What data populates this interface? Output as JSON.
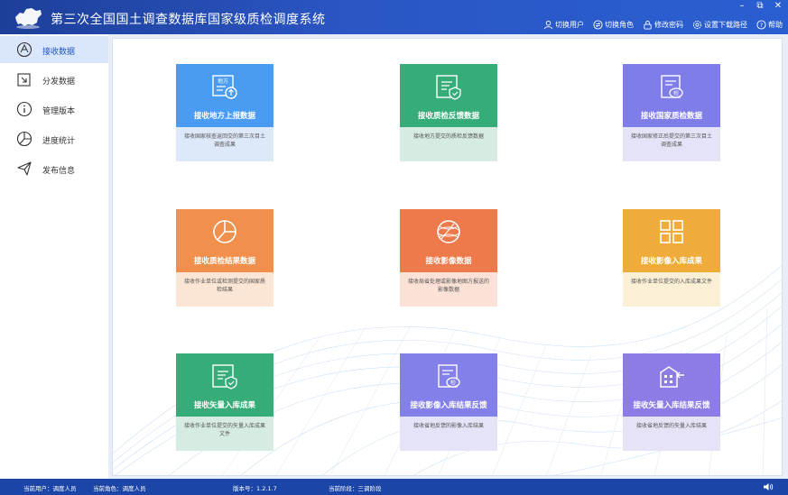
{
  "app": {
    "title": "第三次全国国土调查数据库国家级质检调度系统"
  },
  "window_controls": {
    "minimize": "–",
    "restore": "⧉",
    "close": "✕"
  },
  "toolbar": {
    "switch_user": "切换用户",
    "switch_role": "切换角色",
    "change_password": "修改密码",
    "download_path": "设置下载路径",
    "help": "帮助"
  },
  "sidebar": {
    "items": [
      {
        "label": "接收数据",
        "icon": "receive-data-icon"
      },
      {
        "label": "分发数据",
        "icon": "distribute-data-icon"
      },
      {
        "label": "管理版本",
        "icon": "version-info-icon"
      },
      {
        "label": "进度统计",
        "icon": "pie-chart-icon"
      },
      {
        "label": "发布信息",
        "icon": "send-icon"
      }
    ]
  },
  "cards": [
    {
      "title": "接收地方上报数据",
      "desc": "接收国家核查返回交的第三次目土调查成果",
      "color": "#4a9cf3",
      "bottom": "#dde8f8",
      "icon": "local-report-icon"
    },
    {
      "title": "接收质检反馈数据",
      "desc": "接收地方提交的质检反馈数据",
      "color": "#36ad78",
      "bottom": "#d6ece2",
      "icon": "qc-feedback-icon"
    },
    {
      "title": "接收国家质检数据",
      "desc": "接收国家修正后提交的第三次目土调查成果",
      "color": "#7f7ee8",
      "bottom": "#e4e3f7",
      "icon": "national-check-icon"
    },
    {
      "title": "接收质检结果数据",
      "desc": "接收作业单位或检测提交的国家质检结果",
      "color": "#f0904c",
      "bottom": "#fbe6d5",
      "icon": "pie-result-icon"
    },
    {
      "title": "接收影像数据",
      "desc": "接收局省处理或影像地图方报送的影像数据",
      "color": "#ee7a4b",
      "bottom": "#fbe1d6",
      "icon": "globe-icon"
    },
    {
      "title": "接收影像入库成果",
      "desc": "接收作业单位提交的入库成果文件",
      "color": "#f0ac3a",
      "bottom": "#fbefd6",
      "icon": "grid-icon"
    },
    {
      "title": "接收矢量入库成果",
      "desc": "接收作业单位提交的矢量入库成果文件",
      "color": "#36ad78",
      "bottom": "#d6ece2",
      "icon": "vector-ok-icon"
    },
    {
      "title": "接收影像入库结果反馈",
      "desc": "接收省地反馈的影像入库结果",
      "color": "#8480ea",
      "bottom": "#e4e3f7",
      "icon": "image-feedback-icon"
    },
    {
      "title": "接收矢量入库结果反馈",
      "desc": "接收省地反馈的矢量入库结果",
      "color": "#8d7ce6",
      "bottom": "#e7e3f7",
      "icon": "vector-feedback-icon"
    }
  ],
  "status": {
    "current_user": "当前用户：调度人员",
    "current_role": "当前角色：调度人员",
    "version": "版本号：1.2.1.7",
    "stage": "当前阶段：三调阶段"
  }
}
